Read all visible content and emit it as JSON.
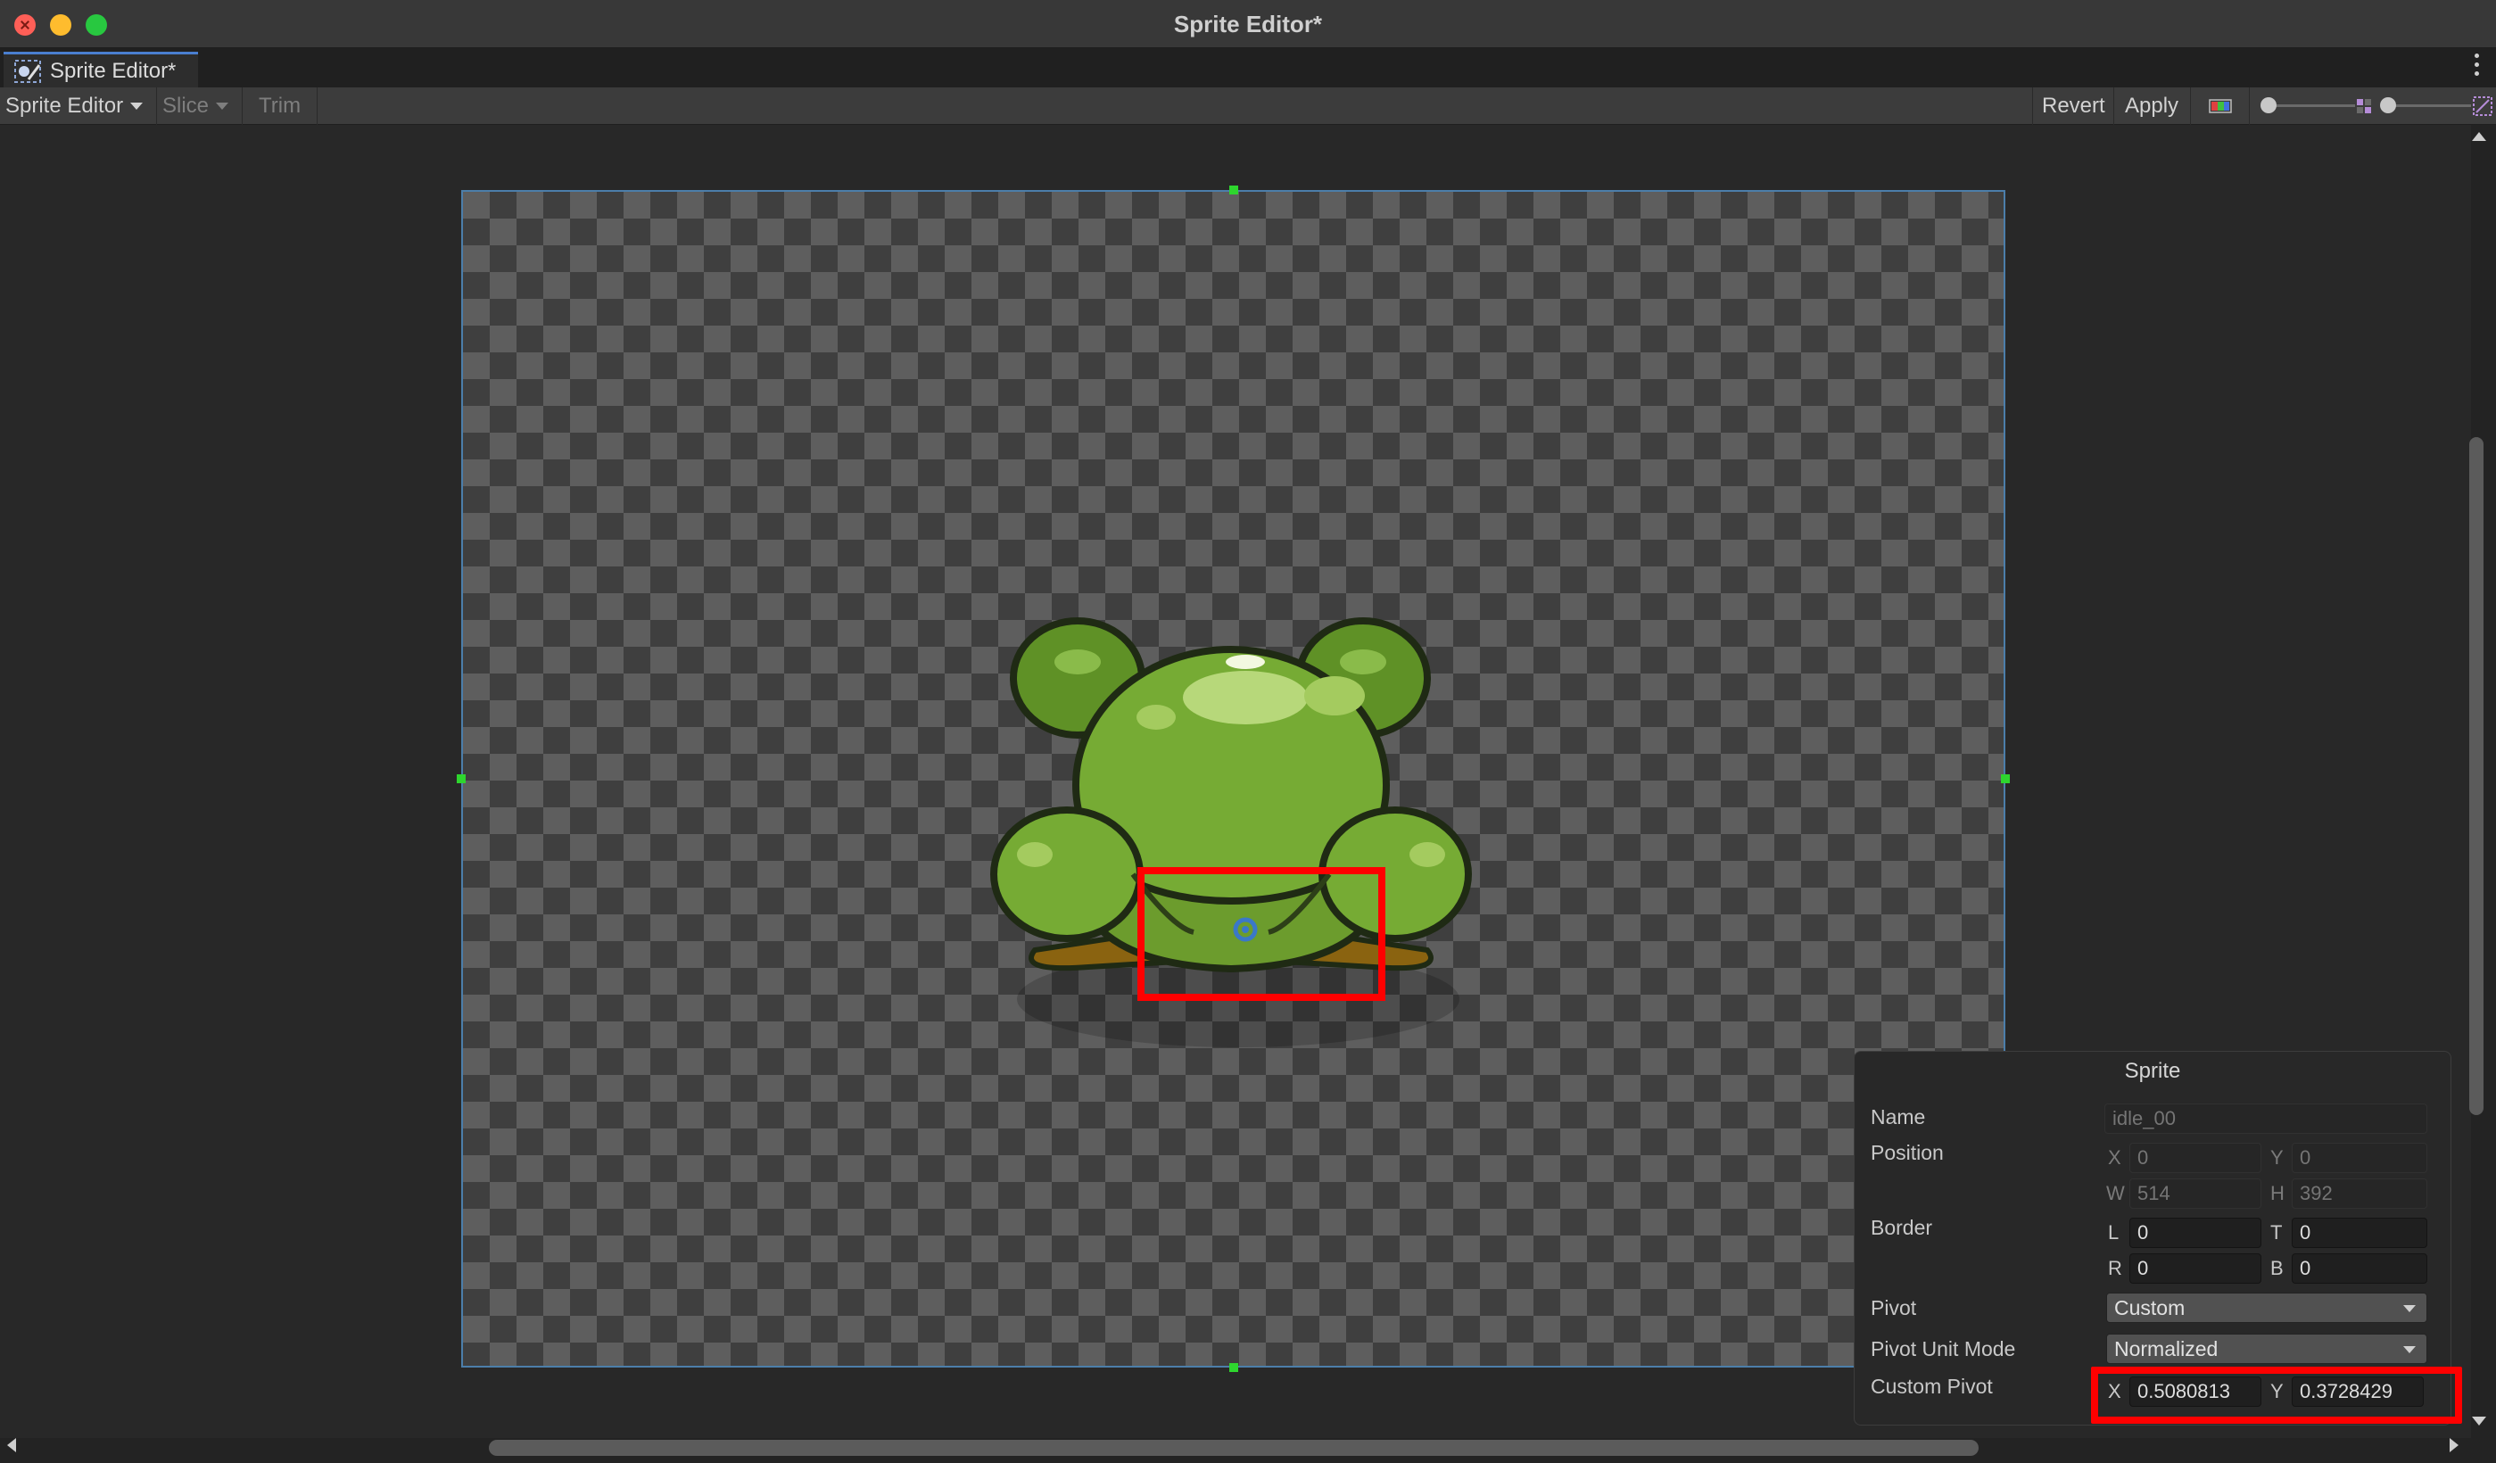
{
  "window": {
    "title": "Sprite Editor*"
  },
  "tab": {
    "label": "Sprite Editor*",
    "icon": "sprite-editor-icon"
  },
  "toolbar": {
    "mode_label": "Sprite Editor",
    "slice_label": "Slice",
    "trim_label": "Trim",
    "revert_label": "Revert",
    "apply_label": "Apply"
  },
  "colors": {
    "highlight": "#ff0000",
    "frame_border": "#4c7eaa",
    "handle": "#2ed62e",
    "frog": "#6fa233"
  },
  "panel": {
    "title": "Sprite",
    "name_label": "Name",
    "name_value": "idle_00",
    "position_label": "Position",
    "x_label": "X",
    "x_value": "0",
    "y_label": "Y",
    "y_value": "0",
    "w_label": "W",
    "w_value": "514",
    "h_label": "H",
    "h_value": "392",
    "border_label": "Border",
    "l_label": "L",
    "l_value": "0",
    "t_label": "T",
    "t_value": "0",
    "r_label": "R",
    "r_value": "0",
    "b_label": "B",
    "b_value": "0",
    "pivot_label": "Pivot",
    "pivot_value": "Custom",
    "pivot_unit_label": "Pivot Unit Mode",
    "pivot_unit_value": "Normalized",
    "custom_pivot_label": "Custom Pivot",
    "custom_x_label": "X",
    "custom_x_value": "0.5080813",
    "custom_y_label": "Y",
    "custom_y_value": "0.3728429"
  }
}
